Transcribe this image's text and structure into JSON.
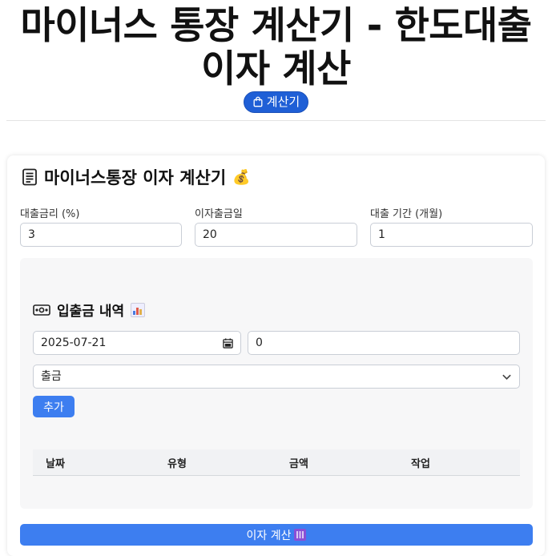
{
  "header": {
    "title": "마이너스 통장 계산기 - 한도대출 이자 계산",
    "badge_label": "계산기"
  },
  "calculator": {
    "title": "마이너스통장 이자 계산기",
    "title_emoji": "💰",
    "fields": [
      {
        "label": "대출금리 (%)",
        "value": "3"
      },
      {
        "label": "이자출금일",
        "value": "20"
      },
      {
        "label": "대출 기간 (개월)",
        "value": "1"
      }
    ],
    "transactions": {
      "title": "입출금 내역",
      "date_value": "2025-07-21",
      "amount_value": "0",
      "type_selected": "출금",
      "add_label": "추가",
      "columns": [
        "날짜",
        "유형",
        "금액",
        "작업"
      ],
      "rows": []
    },
    "calculate_label": "이자 계산"
  },
  "colors": {
    "primary": "#3d7ef0",
    "badge": "#1f5fd6",
    "panel": "#f7f7f8"
  },
  "icons": {
    "badge": "shopping-bag-icon",
    "card_title": "document-icon",
    "transactions": "cash-icon",
    "date": "calendar-icon",
    "select": "chevron-down-icon"
  }
}
